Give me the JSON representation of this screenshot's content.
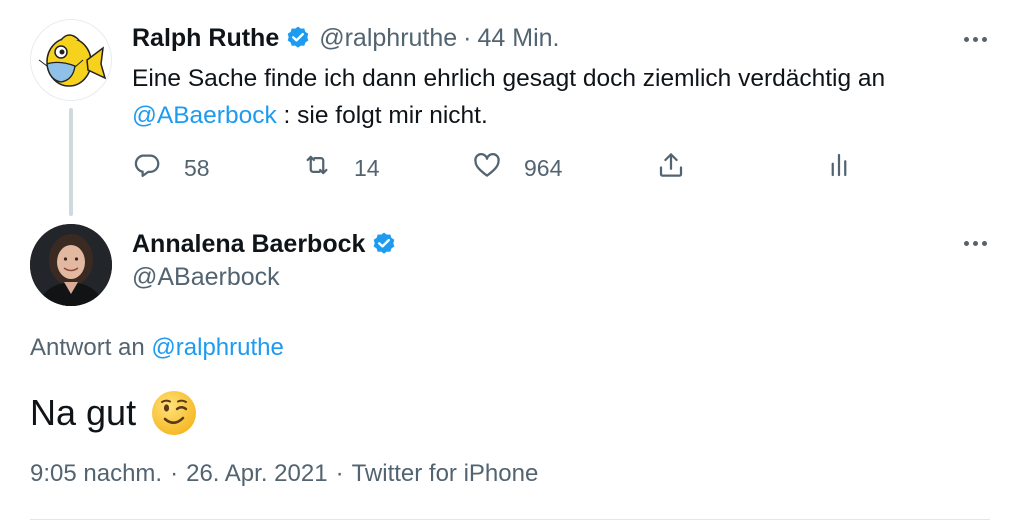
{
  "parent_tweet": {
    "author_name": "Ralph Ruthe",
    "handle": "@ralphruthe",
    "separator": "·",
    "time": "44 Min.",
    "text_line1": "Eine Sache finde ich dann ehrlich gesagt doch ziemlich verdächtig an",
    "mention": "@ABaerbock",
    "text_rest": " : sie folgt mir nicht.",
    "replies": "58",
    "retweets": "14",
    "likes": "964"
  },
  "main_tweet": {
    "author_name": "Annalena Baerbock",
    "handle": "@ABaerbock",
    "reply_prefix": "Antwort an ",
    "reply_mention": "@ralphruthe",
    "text": "Na gut",
    "emoji": "winking-face",
    "time": "9:05 nachm.",
    "separator": "·",
    "date": "26. Apr. 2021",
    "source": "Twitter for iPhone"
  },
  "colors": {
    "verified": "#1d9bf0",
    "link": "#1d9bf0",
    "secondary_text": "#536471",
    "thread_line": "#cfd9de"
  }
}
